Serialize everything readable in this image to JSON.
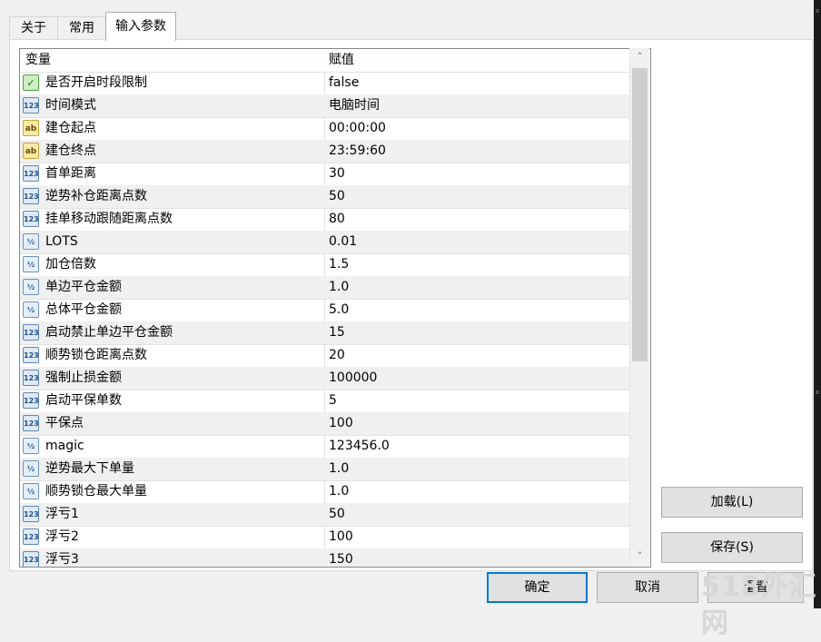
{
  "tabs": [
    {
      "label": "关于"
    },
    {
      "label": "常用"
    },
    {
      "label": "输入参数",
      "active": true
    }
  ],
  "grid": {
    "columns": {
      "variable": "变量",
      "value": "赋值"
    },
    "rows": [
      {
        "name": "是否开启时段限制",
        "value": "false",
        "type": "bool"
      },
      {
        "name": "时间模式",
        "value": "电脑时间",
        "type": "num"
      },
      {
        "name": "建仓起点",
        "value": "00:00:00",
        "type": "ab"
      },
      {
        "name": "建仓终点",
        "value": "23:59:60",
        "type": "ab"
      },
      {
        "name": "首单距离",
        "value": "30",
        "type": "num"
      },
      {
        "name": "逆势补仓距离点数",
        "value": "50",
        "type": "num"
      },
      {
        "name": "挂单移动跟随距离点数",
        "value": "80",
        "type": "num"
      },
      {
        "name": "LOTS",
        "value": "0.01",
        "type": "frac"
      },
      {
        "name": "加仓倍数",
        "value": "1.5",
        "type": "frac"
      },
      {
        "name": "单边平仓金额",
        "value": "1.0",
        "type": "frac"
      },
      {
        "name": "总体平仓金额",
        "value": "5.0",
        "type": "frac"
      },
      {
        "name": "启动禁止单边平仓金额",
        "value": "15",
        "type": "num"
      },
      {
        "name": "顺势锁仓距离点数",
        "value": "20",
        "type": "num"
      },
      {
        "name": "强制止损金额",
        "value": "100000",
        "type": "num"
      },
      {
        "name": "启动平保单数",
        "value": "5",
        "type": "num"
      },
      {
        "name": "平保点",
        "value": "100",
        "type": "num"
      },
      {
        "name": "magic",
        "value": "123456.0",
        "type": "frac"
      },
      {
        "name": "逆势最大下单量",
        "value": "1.0",
        "type": "frac"
      },
      {
        "name": "顺势锁仓最大单量",
        "value": "1.0",
        "type": "frac"
      },
      {
        "name": "浮亏1",
        "value": "50",
        "type": "num"
      },
      {
        "name": "浮亏2",
        "value": "100",
        "type": "num"
      },
      {
        "name": "浮亏3",
        "value": "150",
        "type": "num"
      }
    ]
  },
  "icons": {
    "num": {
      "glyph": "123",
      "semantic": "integer-type-icon"
    },
    "frac": {
      "glyph": "½",
      "semantic": "double-type-icon"
    },
    "ab": {
      "glyph": "ab",
      "semantic": "string-type-icon"
    },
    "bool": {
      "glyph": "✓",
      "semantic": "bool-type-icon"
    }
  },
  "scrollbar": {
    "up": "˄",
    "down": "˅"
  },
  "buttons": {
    "load": "加载(L)",
    "save": "保存(S)",
    "ok": "确定",
    "cancel": "取消",
    "reset": "重置"
  },
  "watermark": "518外汇网"
}
